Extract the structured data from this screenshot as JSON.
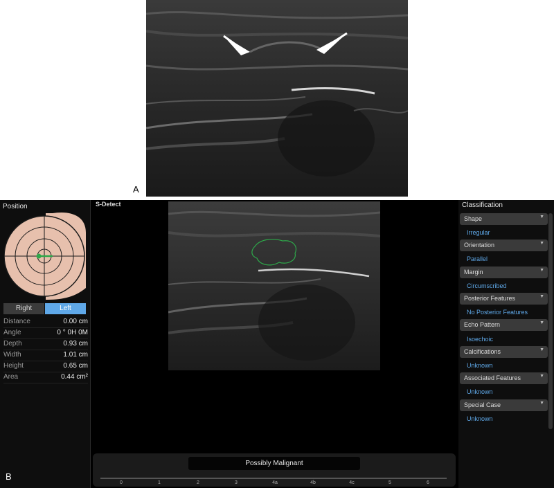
{
  "panel_a": {
    "label": "A"
  },
  "panel_b": {
    "label": "B"
  },
  "left_panel": {
    "title": "Position",
    "buttons": {
      "right": "Right",
      "left": "Left",
      "selected": "Left"
    },
    "measurements": [
      {
        "label": "Distance",
        "value": "0.00 cm"
      },
      {
        "label": "Angle",
        "value": "0 ° 0H 0M"
      },
      {
        "label": "Depth",
        "value": "0.93 cm"
      },
      {
        "label": "Width",
        "value": "1.01 cm"
      },
      {
        "label": "Height",
        "value": "0.65 cm"
      },
      {
        "label": "Area",
        "value": "0.44 cm²"
      }
    ]
  },
  "center": {
    "mode_label": "S-Detect",
    "result": "Possibly Malignant",
    "scale_ticks": [
      "0",
      "1",
      "2",
      "3",
      "4a",
      "4b",
      "4c",
      "5",
      "6"
    ]
  },
  "right_panel": {
    "title": "Classification",
    "items": [
      {
        "label": "Shape",
        "value": "Irregular"
      },
      {
        "label": "Orientation",
        "value": "Parallel"
      },
      {
        "label": "Margin",
        "value": "Circumscribed"
      },
      {
        "label": "Posterior Features",
        "value": "No Posterior Features"
      },
      {
        "label": "Echo Pattern",
        "value": "Isoechoic"
      },
      {
        "label": "Calcifications",
        "value": "Unknown"
      },
      {
        "label": "Associated Features",
        "value": "Unknown"
      },
      {
        "label": "Special Case",
        "value": "Unknown"
      }
    ]
  },
  "colors": {
    "accent": "#5fa8e8",
    "outline": "#2ea84a",
    "breast_diagram": "#e7c0ad"
  }
}
